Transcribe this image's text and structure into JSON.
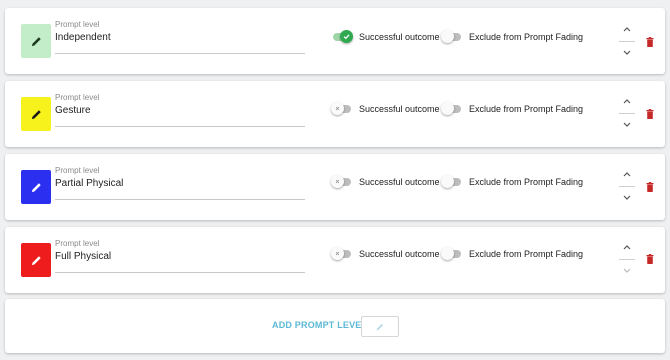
{
  "prompt_levels": [
    {
      "field_label": "Prompt level",
      "name": "Independent",
      "color": "#c3ecc9",
      "icon": "pencil-icon",
      "icon_color": "#1b3a1f",
      "successful_outcome": true,
      "successful_outcome_label": "Successful outcome",
      "exclude_from_fading": false,
      "exclude_label": "Exclude from Prompt Fading"
    },
    {
      "field_label": "Prompt level",
      "name": "Gesture",
      "color": "#f7f11c",
      "icon": "pencil-icon",
      "icon_color": "#1a1a1a",
      "successful_outcome": false,
      "successful_outcome_label": "Successful outcome",
      "exclude_from_fading": false,
      "exclude_label": "Exclude from Prompt Fading"
    },
    {
      "field_label": "Prompt level",
      "name": "Partial Physical",
      "color": "#2b2ff0",
      "icon": "pencil-icon",
      "icon_color": "#ffffff",
      "successful_outcome": false,
      "successful_outcome_label": "Successful outcome",
      "exclude_from_fading": false,
      "exclude_label": "Exclude from Prompt Fading"
    },
    {
      "field_label": "Prompt level",
      "name": "Full Physical",
      "color": "#ee1c1c",
      "icon": "pencil-icon",
      "icon_color": "#ffffff",
      "successful_outcome": false,
      "successful_outcome_label": "Successful outcome",
      "exclude_from_fading": false,
      "exclude_label": "Exclude from Prompt Fading"
    }
  ],
  "add_prompt_level_label": "ADD PROMPT LEVEL",
  "colors": {
    "accent": "#5bb8d6",
    "toggle_on": "#2fa84f",
    "delete": "#c62828"
  }
}
